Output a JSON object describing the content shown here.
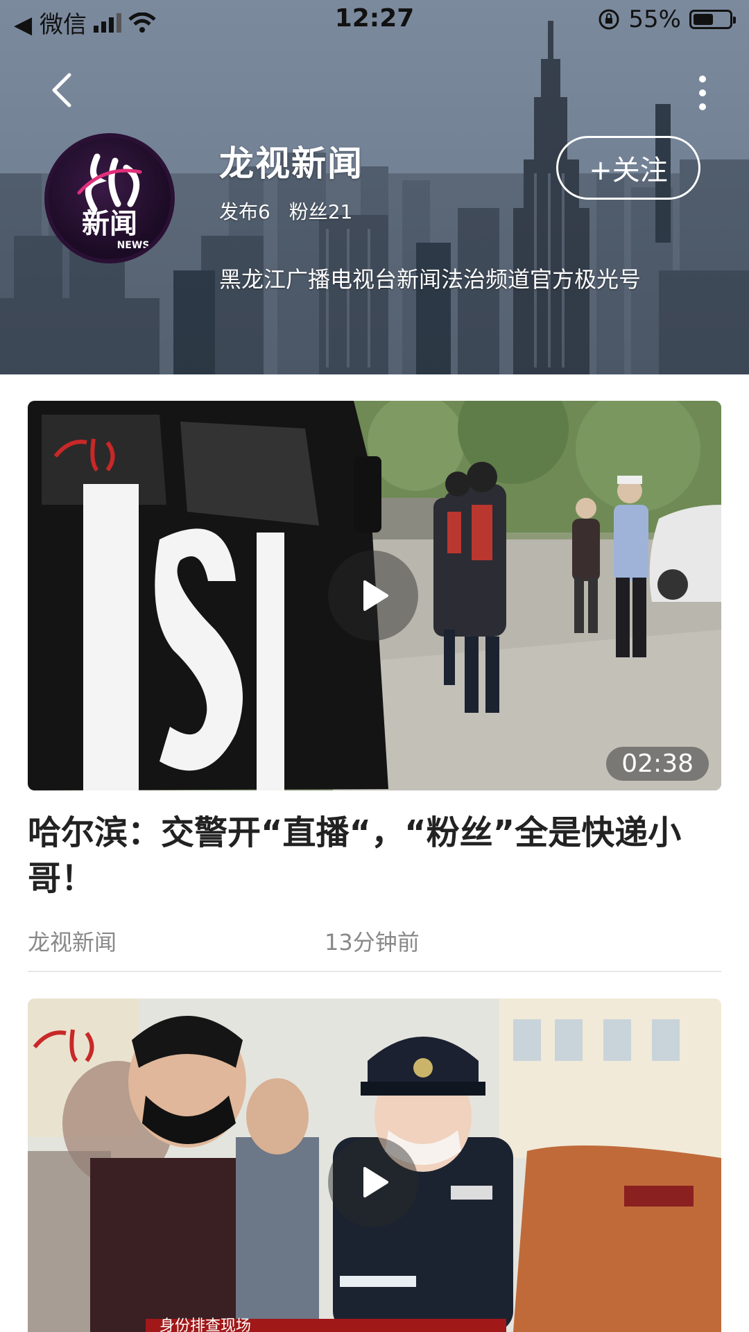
{
  "status_bar": {
    "carrier": "◀ 微信",
    "time": "12:27",
    "battery_percent": "55%",
    "battery_level": 0.55
  },
  "channel": {
    "name": "龙视新闻",
    "posts_label": "发布6",
    "fans_label": "粉丝21",
    "description": "黑龙江广播电视台新闻法治频道官方极光号",
    "follow_label": "+关注",
    "logo_text": "新闻",
    "logo_sub": "NEWS"
  },
  "feed": [
    {
      "title": "哈尔滨：交警开“直播“，“粉丝”全是快递小哥！",
      "source": "龙视新闻",
      "time_ago": "13分钟前",
      "duration": "02:38"
    },
    {
      "caption": "身份排查现场"
    }
  ],
  "colors": {
    "accent_white": "#ffffff",
    "meta_gray": "#888888",
    "title_dark": "#222222"
  }
}
